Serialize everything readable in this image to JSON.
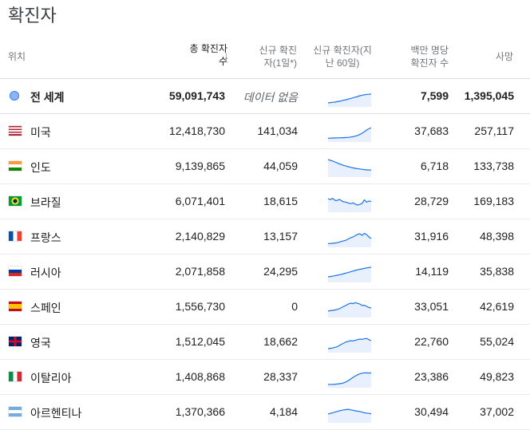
{
  "title": "확진자",
  "headers": {
    "location": "위치",
    "total_line1": "총 확진자",
    "total_line2": "수",
    "sort_arrow": "↓",
    "new_line1": "신규 확진",
    "new_line2": "자(1일*)",
    "trend_line1": "신규 확진자(지",
    "trend_line2": "난 60일)",
    "per_million_line1": "백만 명당",
    "per_million_line2": "확진자 수",
    "deaths": "사망"
  },
  "colors": {
    "accent": "#1a73e8",
    "sparkline_fill": "#e8f0fe"
  },
  "rows": [
    {
      "name": "전 세계",
      "icon": "globe-icon",
      "total": "59,091,743",
      "new": "데이터 없음",
      "per_million": "7,599",
      "deaths": "1,395,045",
      "trend": [
        10,
        12,
        14,
        15,
        18,
        20,
        24,
        27,
        30,
        34,
        38,
        42,
        46,
        50,
        55,
        58,
        61,
        63,
        64,
        66
      ]
    },
    {
      "name": "미국",
      "icon": "us-flag-icon",
      "total": "12,418,730",
      "new": "141,034",
      "per_million": "37,683",
      "deaths": "257,117",
      "trend": [
        8,
        9,
        10,
        10,
        11,
        11,
        12,
        12,
        13,
        14,
        16,
        18,
        22,
        26,
        32,
        40,
        50,
        60,
        68,
        75
      ]
    },
    {
      "name": "인도",
      "icon": "india-flag-icon",
      "total": "9,139,865",
      "new": "44,059",
      "per_million": "6,718",
      "deaths": "133,738",
      "trend": [
        95,
        90,
        86,
        80,
        74,
        68,
        62,
        58,
        54,
        50,
        46,
        43,
        40,
        38,
        36,
        34,
        32,
        30,
        30,
        29
      ]
    },
    {
      "name": "브라질",
      "icon": "brazil-flag-icon",
      "total": "6,071,401",
      "new": "18,615",
      "per_million": "28,729",
      "deaths": "169,183",
      "trend": [
        70,
        64,
        72,
        60,
        58,
        66,
        55,
        50,
        48,
        42,
        38,
        44,
        35,
        30,
        34,
        40,
        62,
        48,
        55,
        52
      ]
    },
    {
      "name": "프랑스",
      "icon": "france-flag-icon",
      "total": "2,140,829",
      "new": "13,157",
      "per_million": "31,916",
      "deaths": "48,398",
      "trend": [
        8,
        9,
        10,
        12,
        14,
        18,
        22,
        26,
        30,
        38,
        45,
        50,
        58,
        66,
        70,
        60,
        72,
        65,
        50,
        40
      ]
    },
    {
      "name": "러시아",
      "icon": "russia-flag-icon",
      "total": "2,071,858",
      "new": "24,295",
      "per_million": "14,119",
      "deaths": "35,838",
      "trend": [
        20,
        22,
        24,
        27,
        30,
        33,
        36,
        40,
        44,
        48,
        52,
        56,
        60,
        64,
        67,
        70,
        73,
        76,
        78,
        80
      ]
    },
    {
      "name": "스페인",
      "icon": "spain-flag-icon",
      "total": "1,556,730",
      "new": "0",
      "per_million": "33,051",
      "deaths": "42,619",
      "trend": [
        25,
        28,
        30,
        32,
        36,
        40,
        48,
        55,
        62,
        70,
        75,
        72,
        78,
        74,
        70,
        60,
        62,
        55,
        48,
        45
      ]
    },
    {
      "name": "영국",
      "icon": "uk-flag-icon",
      "total": "1,512,045",
      "new": "18,662",
      "per_million": "22,760",
      "deaths": "55,024",
      "trend": [
        10,
        12,
        14,
        18,
        22,
        30,
        38,
        45,
        52,
        56,
        60,
        58,
        62,
        66,
        70,
        68,
        72,
        74,
        66,
        60
      ]
    },
    {
      "name": "이탈리아",
      "icon": "italy-flag-icon",
      "total": "1,408,868",
      "new": "28,337",
      "per_million": "23,386",
      "deaths": "49,823",
      "trend": [
        5,
        6,
        6,
        7,
        8,
        10,
        12,
        16,
        22,
        30,
        40,
        50,
        58,
        66,
        72,
        76,
        78,
        78,
        77,
        78
      ]
    },
    {
      "name": "아르헨티나",
      "icon": "argentina-flag-icon",
      "total": "1,370,366",
      "new": "4,184",
      "per_million": "30,494",
      "deaths": "37,002",
      "trend": [
        40,
        44,
        48,
        52,
        56,
        60,
        64,
        66,
        68,
        70,
        66,
        64,
        60,
        58,
        56,
        52,
        48,
        46,
        44,
        42
      ]
    }
  ]
}
